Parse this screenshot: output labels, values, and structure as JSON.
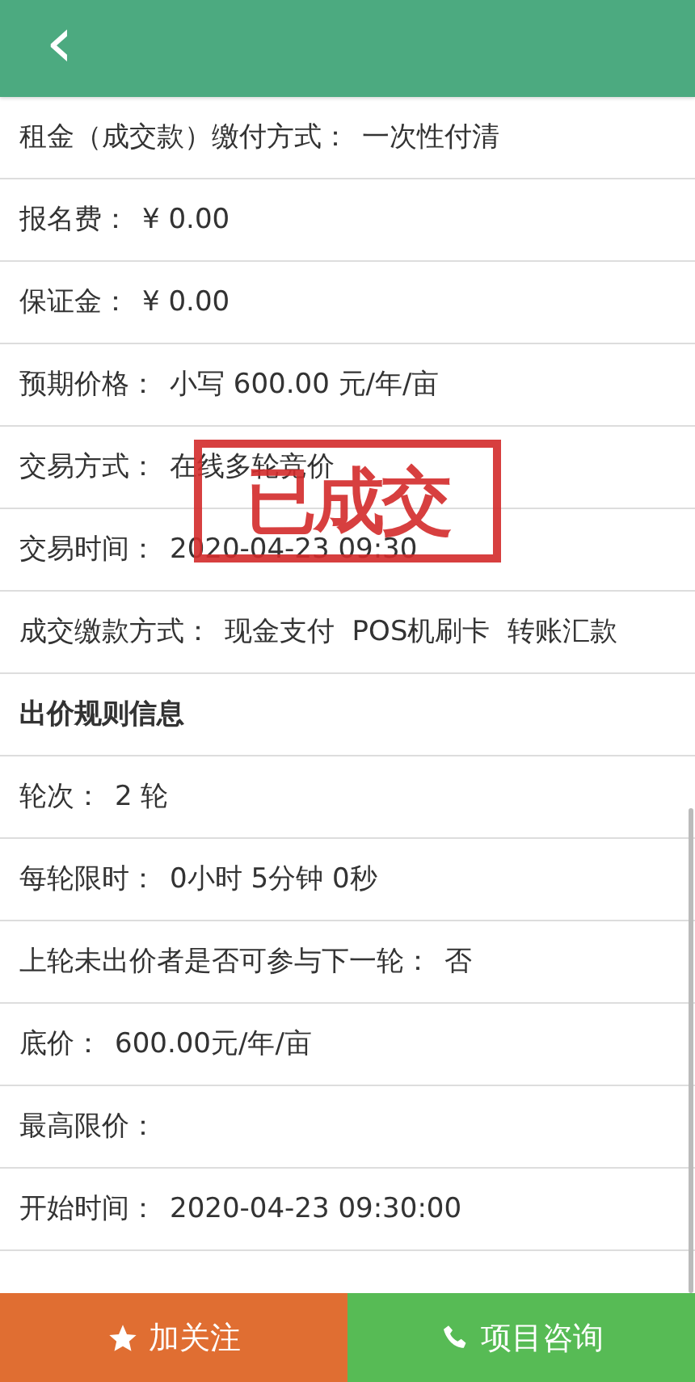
{
  "header": {
    "back": "‹"
  },
  "rows": [
    {
      "kind": "field",
      "label": "租金（成交款）缴付方式：",
      "value": "一次性付清"
    },
    {
      "kind": "field",
      "label": "报名费：",
      "value": "¥ 0.00"
    },
    {
      "kind": "field",
      "label": "保证金：",
      "value": "¥ 0.00"
    },
    {
      "kind": "field",
      "label": "预期价格：",
      "value": "小写 600.00 元/年/亩"
    },
    {
      "kind": "field",
      "label": "交易方式：",
      "value": "在线多轮竞价"
    },
    {
      "kind": "field",
      "label": "交易时间：",
      "value": "2020-04-23 09:30"
    },
    {
      "kind": "field",
      "label": "成交缴款方式：",
      "value": "现金支付  POS机刷卡  转账汇款"
    },
    {
      "kind": "section",
      "label": "出价规则信息"
    },
    {
      "kind": "field",
      "label": "轮次：",
      "value": "2 轮"
    },
    {
      "kind": "field",
      "label": "每轮限时：",
      "value": "0小时 5分钟 0秒"
    },
    {
      "kind": "field",
      "label": "上轮未出价者是否可参与下一轮：",
      "value": "否"
    },
    {
      "kind": "field",
      "label": "底价：",
      "value": "600.00元/年/亩"
    },
    {
      "kind": "field",
      "label": "最高限价："
    },
    {
      "kind": "field",
      "label": "开始时间：",
      "value": "2020-04-23 09:30:00"
    }
  ],
  "stamp": {
    "text": "已成交"
  },
  "footer": {
    "follow": "加关注",
    "consult": "项目咨询"
  }
}
